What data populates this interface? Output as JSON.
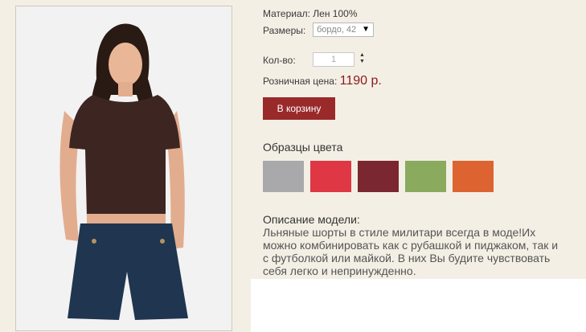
{
  "product": {
    "material": "Материал: Лен 100%",
    "sizes_label": "Размеры:",
    "size_selected": "бордо, 42",
    "qty_label": "Кол-во:",
    "qty_value": "1",
    "price_label": "Розничная цена:",
    "price_value": "1190 р.",
    "cart_button": "В корзину"
  },
  "swatches": {
    "title": "Образцы цвета",
    "colors": [
      "#a9a9ab",
      "#e03744",
      "#7b2732",
      "#8aaa5e",
      "#dd6430"
    ]
  },
  "description": {
    "title": "Описание модели:",
    "text": "Льняные шорты в стиле милитари всегда в моде!Их можно комбинировать как с рубашкой и пиджаком, так и с футболкой или майкой. В них Вы будите чувствовать себя легко и непринужденно."
  }
}
